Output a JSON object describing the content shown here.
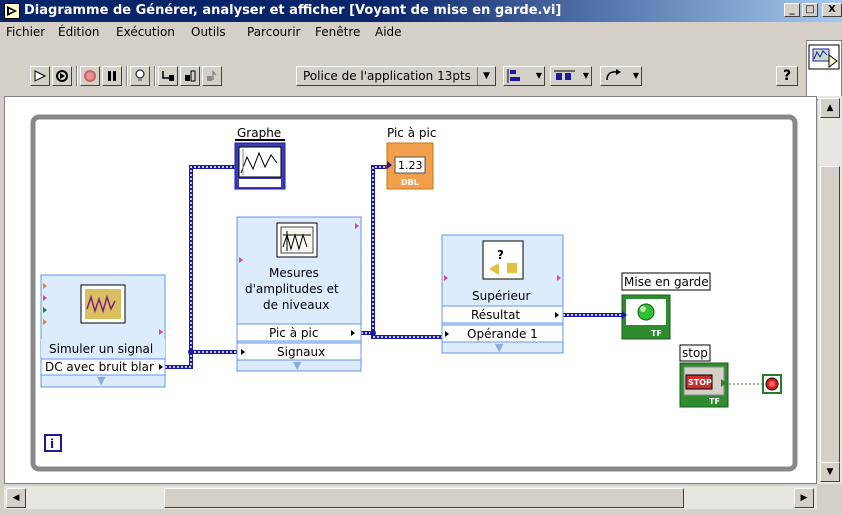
{
  "window": {
    "title": "Diagramme de Générer, analyser et afficher [Voyant de mise en garde.vi]",
    "buttons": {
      "minimize": "_",
      "maximize": "□",
      "close": "X"
    }
  },
  "menu": {
    "items": [
      "Fichier",
      "Édition",
      "Exécution",
      "Outils",
      "Parcourir",
      "Fenêtre",
      "Aide"
    ]
  },
  "toolbar": {
    "font_select": "Police de l'application 13pts",
    "help": "?"
  },
  "diagram": {
    "graph_label": "Graphe",
    "pic_label": "Pic à pic",
    "pic_indicator_value": "1.23",
    "pic_indicator_type": "DBL",
    "simulate": {
      "title": "Simuler un signal",
      "param": "DC avec bruit blar"
    },
    "measure": {
      "title_line1": "Mesures",
      "title_line2": "d'amplitudes et",
      "title_line3": "de niveaux",
      "out_pic": "Pic à pic",
      "in_signals": "Signaux"
    },
    "greater": {
      "title": "Supérieur",
      "result": "Résultat",
      "operand": "Opérande 1"
    },
    "alert_label": "Mise en garde",
    "alert_type": "TF",
    "stop_label": "stop",
    "stop_button_text": "STOP",
    "stop_type": "TF",
    "info_icon": "i"
  },
  "colors": {
    "titlebar_start": "#0a246a",
    "titlebar_end": "#a6caf0",
    "wire_dynamic": "#1a1aa0",
    "wire_boolean": "#2a7a2a",
    "boolean_green": "#2e8b2e",
    "numeric_orange": "#f0a04a",
    "loop_gray": "#888888"
  }
}
